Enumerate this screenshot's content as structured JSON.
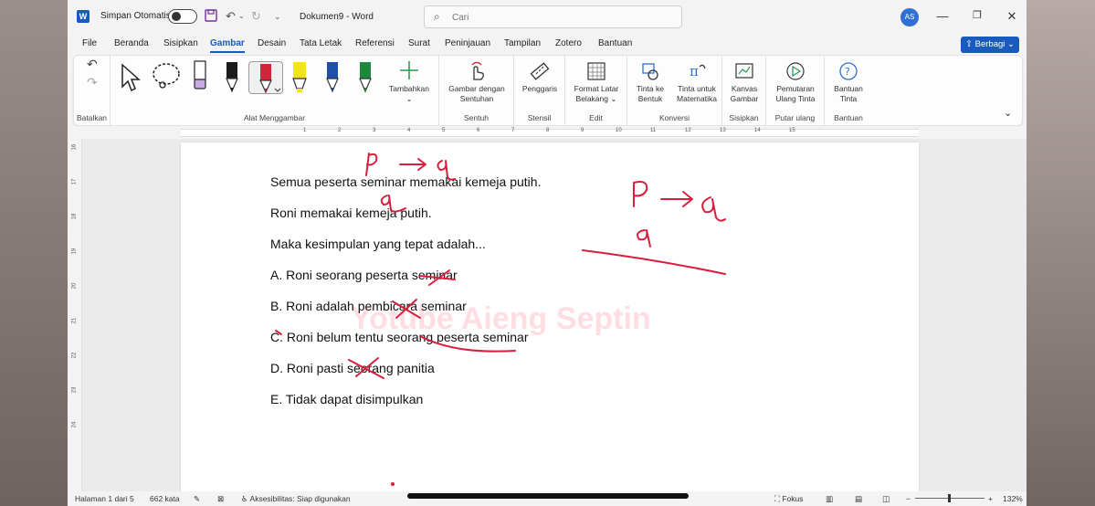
{
  "titlebar": {
    "app_logo": "W",
    "autosave_label": "Simpan Otomatis",
    "doc_title": "Dokumen9 - Word",
    "search_placeholder": "Cari",
    "avatar": "AS",
    "icons": [
      "save-icon",
      "undo-icon",
      "redo-icon",
      "customize-icon",
      "minimize-icon",
      "restore-icon",
      "close-icon"
    ]
  },
  "menu": {
    "tabs": [
      "File",
      "Beranda",
      "Sisipkan",
      "Gambar",
      "Desain",
      "Tata Letak",
      "Referensi",
      "Surat",
      "Peninjauan",
      "Tampilan",
      "Zotero",
      "Bantuan"
    ],
    "active_tab": "Gambar",
    "share_label": "Berbagi"
  },
  "ribbon": {
    "groups": {
      "undo": "Batalkan",
      "tools": "Alat Menggambar",
      "touch": "Sentuh",
      "stencil": "Stensil",
      "edit": "Edit",
      "convert": "Konversi",
      "insert": "Sisipkan",
      "replay": "Putar ulang",
      "help": "Bantuan"
    },
    "buttons": {
      "add_pen": "Tambahkan",
      "draw_touch_1": "Gambar dengan",
      "draw_touch_2": "Sentuhan",
      "ruler": "Penggaris",
      "bg_format_1": "Format Latar",
      "bg_format_2": "Belakang",
      "ink_shape_1": "Tinta ke",
      "ink_shape_2": "Bentuk",
      "ink_math_1": "Tinta untuk",
      "ink_math_2": "Matematika",
      "canvas_1": "Kanvas",
      "canvas_2": "Gambar",
      "replay_1": "Pemutaran",
      "replay_2": "Ulang Tinta",
      "help_1": "Bantuan",
      "help_2": "Tinta"
    },
    "pen_colors": [
      "#1a1a1a",
      "#d0263c",
      "#f2e31b",
      "#1f4fa8",
      "#1c8a3a"
    ],
    "selected_pen": 1
  },
  "ruler": {
    "top_labels": [
      "1",
      "2",
      "3",
      "4",
      "5",
      "6",
      "7",
      "8",
      "9",
      "10",
      "11",
      "12",
      "13",
      "14",
      "15"
    ],
    "side_labels": [
      "16",
      "17",
      "18",
      "19",
      "20",
      "21",
      "22",
      "23",
      "24"
    ]
  },
  "document": {
    "lines": [
      "Semua peserta seminar memakai kemeja putih.",
      "Roni memakai kemeja putih.",
      "Maka kesimpulan yang tepat adalah...",
      "A. Roni seorang peserta seminar",
      "B. Roni adalah pembicara seminar",
      "C. Roni belum tentu seorang peserta seminar",
      "D. Roni pasti seorang panitia",
      "E. Tidak dapat disimpulkan"
    ],
    "watermark": "Yotube Aieng Septin",
    "ink_color": "#d81e3c"
  },
  "status": {
    "page": "Halaman 1 dari 5",
    "words": "662 kata",
    "accessibility": "Aksesibilitas: Siap digunakan",
    "focus": "Fokus",
    "zoom": "132%",
    "zoom_out": "−",
    "zoom_in": "+"
  }
}
